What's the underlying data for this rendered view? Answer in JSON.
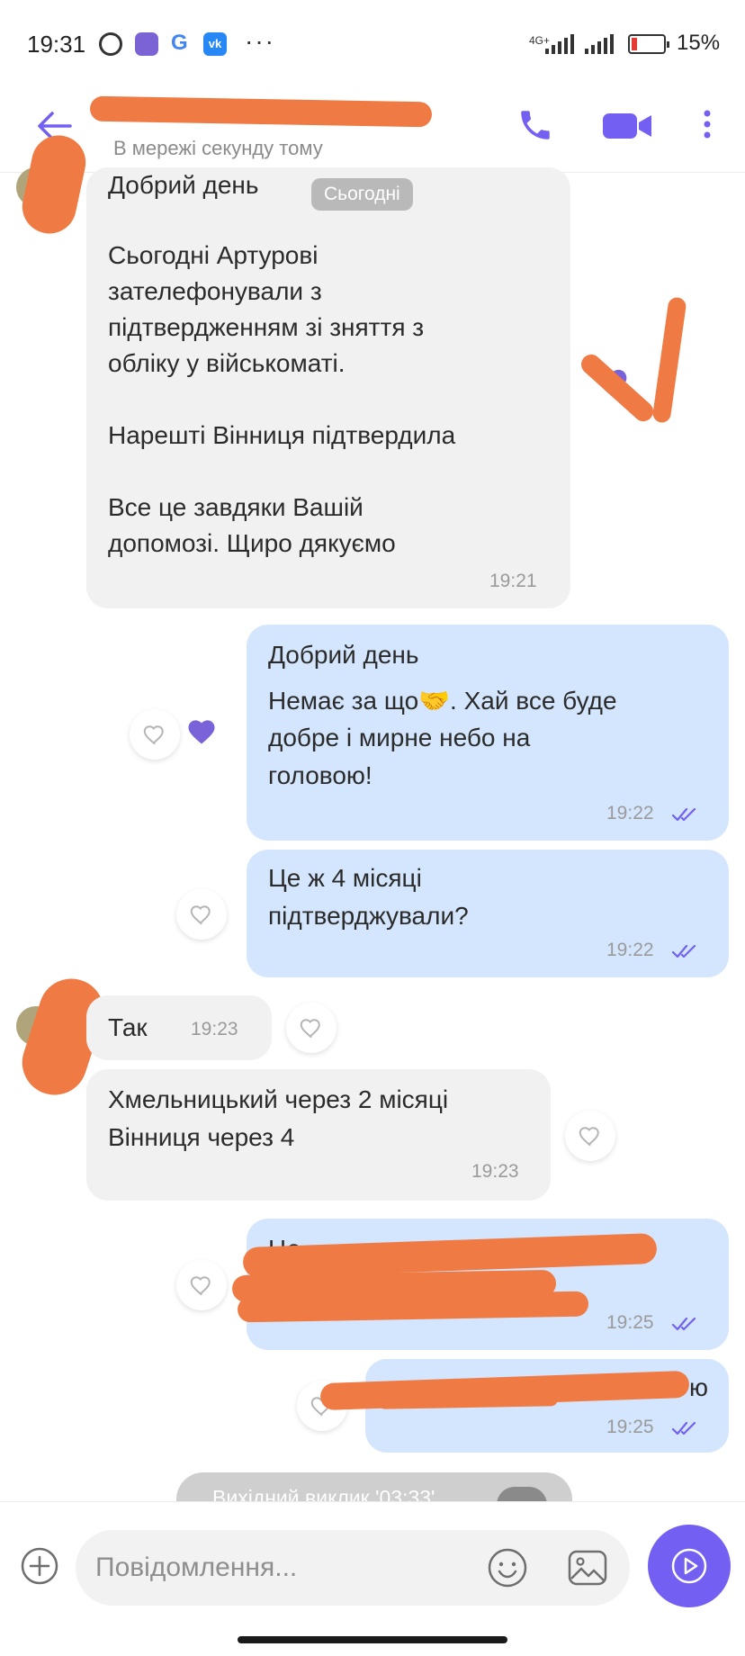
{
  "status_bar": {
    "time": "19:31",
    "more": "···",
    "network": "4G+",
    "battery_text": "15%",
    "battery_level": 0.15
  },
  "header": {
    "contact_name": "",
    "status": "В мережі секунду тому"
  },
  "date_badge": "Сьогодні",
  "messages": [
    {
      "direction": "incoming",
      "lines": [
        "Добрий день",
        "",
        "Сьогодні Артурові",
        "зателефонували з",
        "підтвердженням зі зняття з",
        "обліку у військоматі.",
        "",
        "Нарешті Вінниця підтвердила",
        "",
        "Все це завдяки Вашій",
        "допомозі. Щиро дякуємо"
      ],
      "time": "19:21",
      "reaction": "heart-filled"
    },
    {
      "direction": "outgoing",
      "lines": [
        "Добрий день",
        "Немає за що🤝. Хай все буде",
        "добре і мирне небо на",
        "головою!"
      ],
      "time": "19:22",
      "reaction": "heart-filled"
    },
    {
      "direction": "outgoing",
      "lines": [
        "Це ж 4 місяці",
        "підтверджували?"
      ],
      "time": "19:22"
    },
    {
      "direction": "incoming",
      "lines": [
        "Так"
      ],
      "time": "19:23"
    },
    {
      "direction": "incoming",
      "lines": [
        "Хмельницький через 2 місяці",
        "Вінниця через 4"
      ],
      "time": "19:23"
    },
    {
      "direction": "outgoing",
      "lines": [
        "Це"
      ],
      "time": "19:25"
    },
    {
      "direction": "outgoing",
      "lines": [
        "ю"
      ],
      "time": "19:25"
    }
  ],
  "call_event": "Вихідний виклик '03:33'",
  "composer": {
    "placeholder": "Повідомлення..."
  },
  "colors": {
    "accent": "#7360f2",
    "incoming_bubble": "#f1f1f1",
    "outgoing_bubble": "#d4e6fd",
    "redaction": "#f07a44"
  }
}
